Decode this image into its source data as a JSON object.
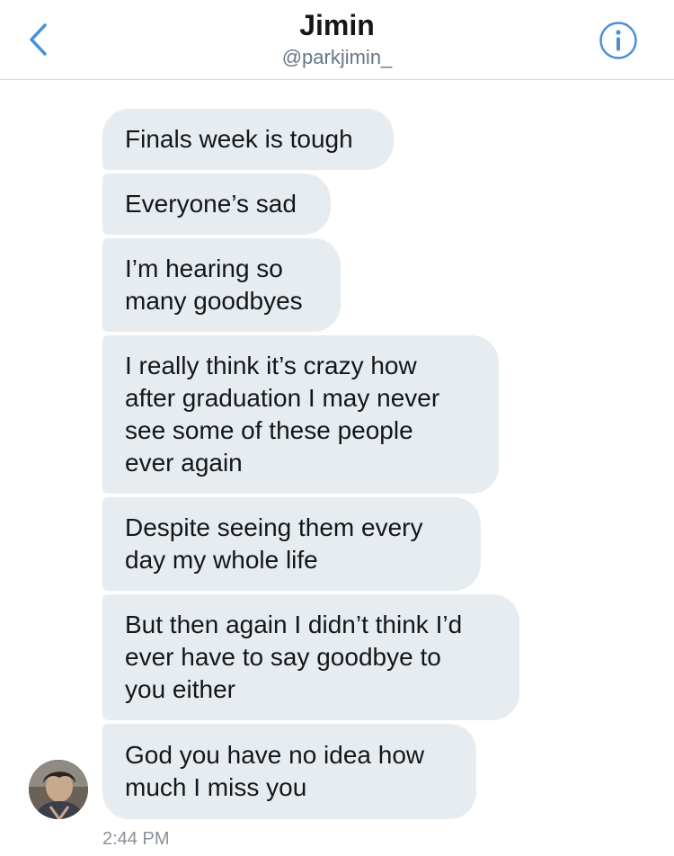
{
  "header": {
    "back_icon": "chevron-left-icon",
    "name": "Jimin",
    "handle": "@parkjimin_",
    "info_icon": "info-icon",
    "accent_color": "#4a90d9"
  },
  "messages": [
    {
      "text": "Finals week is tough"
    },
    {
      "text": "Everyone’s sad"
    },
    {
      "text": "I’m hearing so\nmany goodbyes"
    },
    {
      "text": "I really think it’s crazy how\nafter graduation I may never\nsee some of these people\never again"
    },
    {
      "text": "Despite seeing them every\nday my whole life"
    },
    {
      "text": "But then again I didn’t think I’d\never have to say goodbye to\nyou either"
    },
    {
      "text": "God you have no idea how\nmuch I miss you"
    }
  ],
  "timestamp": "2:44 PM",
  "colors": {
    "bubble_bg": "#e6ecf0",
    "text": "#14171a",
    "secondary_text": "#657786"
  }
}
